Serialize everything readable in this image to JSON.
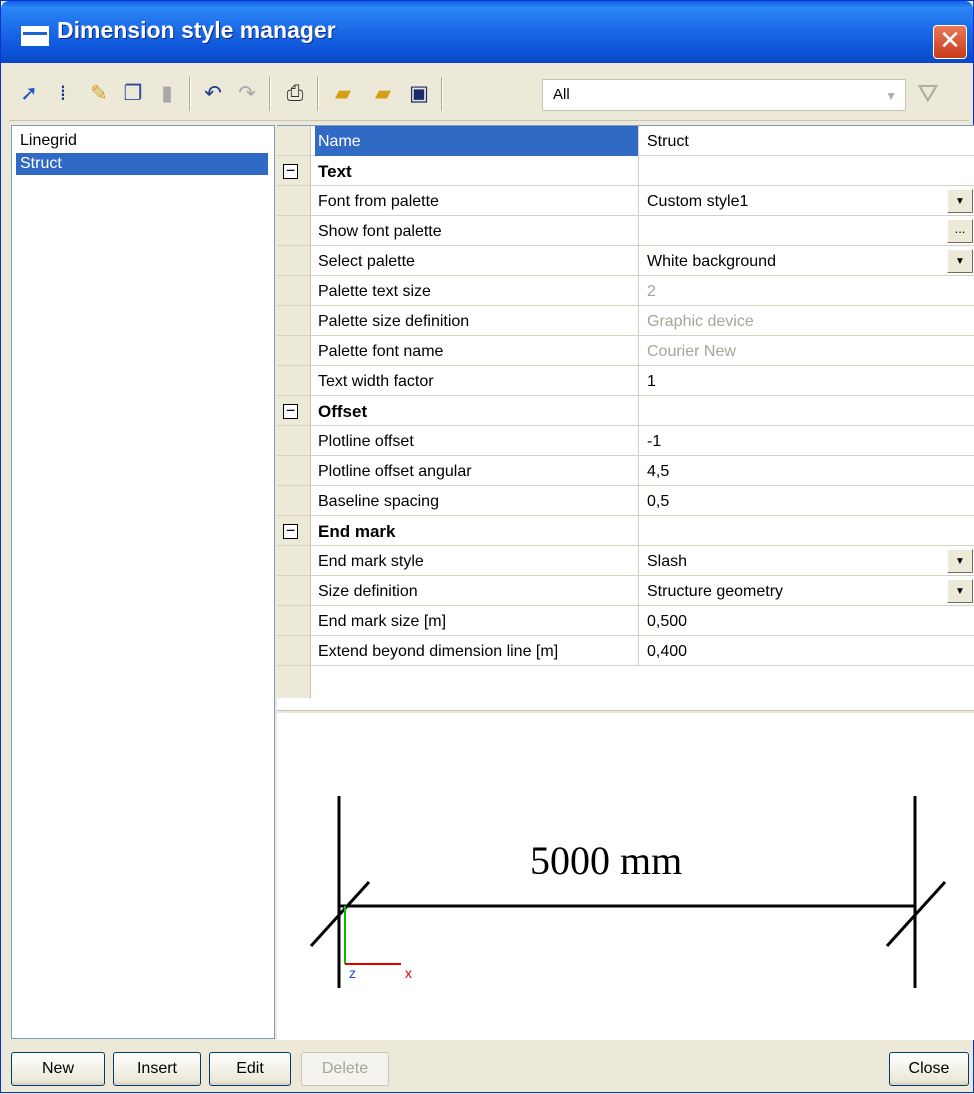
{
  "window": {
    "title": "Dimension style manager",
    "close_label": "✕"
  },
  "toolbar": {
    "filter_value": "All",
    "icons": [
      "new-style-icon",
      "properties-icon",
      "edit-icon",
      "copy-icon",
      "delete-icon",
      "undo-icon",
      "redo-icon",
      "print-icon",
      "open-folder-icon",
      "import-folder-icon",
      "save-icon",
      "filter-icon"
    ]
  },
  "styles_list": {
    "items": [
      {
        "label": "Linegrid"
      },
      {
        "label": "Struct"
      }
    ],
    "selected": "Struct"
  },
  "properties": {
    "header": {
      "name": "Name",
      "value": "Struct"
    },
    "sections": [
      {
        "title": "Text",
        "rows": [
          {
            "name": "Font from palette",
            "value": "Custom style1"
          },
          {
            "name": "Show font palette",
            "value": ""
          },
          {
            "name": "Select palette",
            "value": "White background"
          },
          {
            "name": "Palette text size",
            "value": "2"
          },
          {
            "name": "Palette size definition",
            "value": "Graphic device"
          },
          {
            "name": "Palette font name",
            "value": "Courier New"
          },
          {
            "name": "Text width factor",
            "value": "1"
          }
        ]
      },
      {
        "title": "Offset",
        "rows": [
          {
            "name": "Plotline offset",
            "value": "-1"
          },
          {
            "name": "Plotline offset angular",
            "value": "4,5"
          },
          {
            "name": "Baseline spacing",
            "value": "0,5"
          }
        ]
      },
      {
        "title": "End mark",
        "rows": [
          {
            "name": "End mark style",
            "value": "Slash"
          },
          {
            "name": "Size definition",
            "value": "Structure geometry"
          },
          {
            "name": "End mark size [m]",
            "value": "0,500"
          },
          {
            "name": "Extend beyond dimension line [m]",
            "value": "0,400"
          }
        ]
      }
    ]
  },
  "preview": {
    "dimension_text": "5000 mm",
    "axis_x": "x",
    "axis_z": "z"
  },
  "buttons": {
    "new": "New",
    "insert": "Insert",
    "edit": "Edit",
    "delete": "Delete",
    "close": "Close"
  }
}
